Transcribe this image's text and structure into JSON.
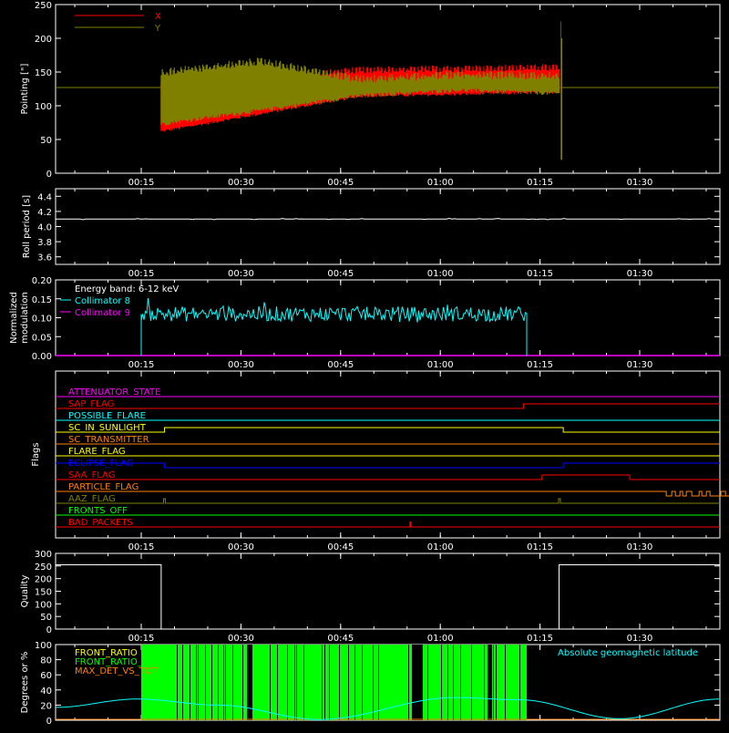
{
  "time_ticks": [
    "00:15",
    "00:30",
    "00:45",
    "01:00",
    "01:15",
    "01:30"
  ],
  "chart_data": [
    {
      "type": "line",
      "ylabel": "Pointing [\"]",
      "ylim": [
        0,
        250
      ],
      "yticks": [
        "0",
        "50",
        "100",
        "150",
        "200",
        "250"
      ],
      "legend": [
        {
          "name": "X",
          "color": "#ff0000"
        },
        {
          "name": "Y",
          "color": "#808000"
        }
      ],
      "series": [
        {
          "name": "X",
          "color": "#ff0000",
          "start": "00:18",
          "end": "01:18",
          "x_band": [
            [
              60,
              140
            ],
            [
              112,
              158
            ],
            [
              118,
              162
            ]
          ],
          "baseline": 127
        },
        {
          "name": "Y",
          "color": "#808000",
          "start": "00:18",
          "end": "01:18",
          "y_band": [
            [
              70,
              155
            ],
            [
              90,
              172
            ],
            [
              112,
              145
            ],
            [
              120,
              152
            ],
            [
              115,
              150
            ]
          ],
          "baseline": 127
        }
      ]
    },
    {
      "type": "line",
      "ylabel": "Roll period [s]",
      "ylim": [
        3.5,
        4.5
      ],
      "yticks": [
        "3.6",
        "3.8",
        "4.0",
        "4.2",
        "4.4"
      ],
      "series": [
        {
          "name": "",
          "color": "#ffffff",
          "value": 4.1
        }
      ]
    },
    {
      "type": "line",
      "ylabel": "Normalized modulation",
      "ylim": [
        0,
        0.2
      ],
      "yticks": [
        "0.00",
        "0.05",
        "0.10",
        "0.15",
        "0.20"
      ],
      "legend_title": "Energy band: 6-12 keV",
      "legend": [
        {
          "name": "Collimator 8",
          "color": "#00ffff"
        },
        {
          "name": "Collimator 9",
          "color": "#ff00ff"
        }
      ],
      "series": [
        {
          "name": "Collimator 8",
          "color": "#00ffff",
          "start": "00:15",
          "end": "01:13",
          "mean": 0.11
        },
        {
          "name": "Collimator 9",
          "color": "#ff00ff",
          "value": 0.0
        }
      ]
    },
    {
      "type": "line",
      "ylabel": "Flags",
      "flags": [
        {
          "name": "ATTENUATOR_STATE",
          "color": "#ff00ff"
        },
        {
          "name": "SAP_FLAG",
          "color": "#ff0000"
        },
        {
          "name": "POSSIBLE_FLARE",
          "color": "#00ffff"
        },
        {
          "name": "SC_IN_SUNLIGHT",
          "color": "#ffff00"
        },
        {
          "name": "SC_TRANSMITTER",
          "color": "#ff8000"
        },
        {
          "name": "FLARE_FLAG",
          "color": "#ffff00"
        },
        {
          "name": "ECLIPSE_FLAG",
          "color": "#0000ff"
        },
        {
          "name": "SAA_FLAG",
          "color": "#ff0000"
        },
        {
          "name": "PARTICLE_FLAG",
          "color": "#ff8000"
        },
        {
          "name": "AAZ_FLAG",
          "color": "#808000"
        },
        {
          "name": "FRONTS_OFF",
          "color": "#00ff00"
        },
        {
          "name": "BAD_PACKETS",
          "color": "#ff0000"
        }
      ]
    },
    {
      "type": "line",
      "ylabel": "Quality",
      "ylim": [
        0,
        300
      ],
      "yticks": [
        "0",
        "50",
        "100",
        "150",
        "200",
        "250",
        "300"
      ],
      "series": [
        {
          "name": "",
          "color": "#ffffff",
          "high": 255,
          "low": 0,
          "drop_start": "00:18",
          "rise": "01:18"
        }
      ]
    },
    {
      "type": "line",
      "ylabel": "Degrees or %",
      "ylim": [
        0,
        100
      ],
      "yticks": [
        "0",
        "20",
        "40",
        "60",
        "80",
        "100"
      ],
      "legend": [
        {
          "name": "FRONT_RATIO",
          "color": "#ffff00"
        },
        {
          "name": "FRONT_RATIO_1225",
          "color": "#00ff00"
        },
        {
          "name": "MAX_DET_VS_TOT",
          "color": "#ff8000"
        }
      ],
      "annotation": "Absolute geomagnetic latitude",
      "annotation_color": "#00ffff",
      "series": [
        {
          "name": "FRONT_RATIO_1225",
          "color": "#00ff00",
          "start": "00:15",
          "end": "01:13"
        },
        {
          "name": "Absolute geomagnetic latitude",
          "color": "#00ffff"
        }
      ]
    }
  ]
}
